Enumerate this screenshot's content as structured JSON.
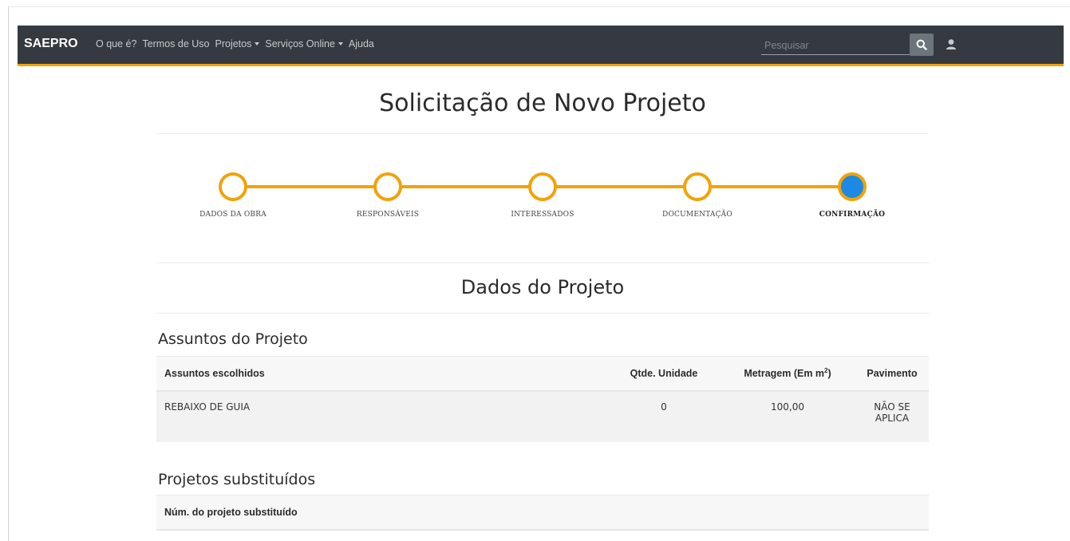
{
  "navbar": {
    "brand": "SAEPRO",
    "items": [
      {
        "label": "O que é?",
        "dropdown": false
      },
      {
        "label": "Termos de Uso",
        "dropdown": false
      },
      {
        "label": "Projetos",
        "dropdown": true
      },
      {
        "label": "Serviços Online",
        "dropdown": true
      },
      {
        "label": "Ajuda",
        "dropdown": false
      }
    ],
    "search_placeholder": "Pesquisar",
    "accent_color": "#f0a30a",
    "background_color": "#343a40",
    "icons": [
      "search-icon",
      "user-icon"
    ]
  },
  "page": {
    "title": "Solicitação de Novo Projeto"
  },
  "stepper": {
    "steps": [
      {
        "label": "DADOS DA OBRA"
      },
      {
        "label": "RESPONSÁVEIS"
      },
      {
        "label": "INTERESSADOS"
      },
      {
        "label": "DOCUMENTAÇÃO"
      },
      {
        "label": "CONFIRMAÇÃO"
      }
    ],
    "active_step": "CONFIRMAÇÃO",
    "active_color": "#1e88e5"
  },
  "project": {
    "section_title": "Dados do Projeto",
    "subjects": {
      "title": "Assuntos do Projeto",
      "headers": [
        "Assuntos escolhidos",
        "Qtde. Unidade",
        "Metragem (Em m",
        "2",
        ")",
        "Pavimento"
      ],
      "rows": [
        {
          "subject": "REBAIXO DE GUIA",
          "qty": "0",
          "area": "100,00",
          "floor_line1": "NÃO SE",
          "floor_line2": "APLICA"
        }
      ]
    },
    "replaced": {
      "title": "Projetos substituídos",
      "headers": [
        "Núm. do projeto substituído"
      ]
    }
  }
}
